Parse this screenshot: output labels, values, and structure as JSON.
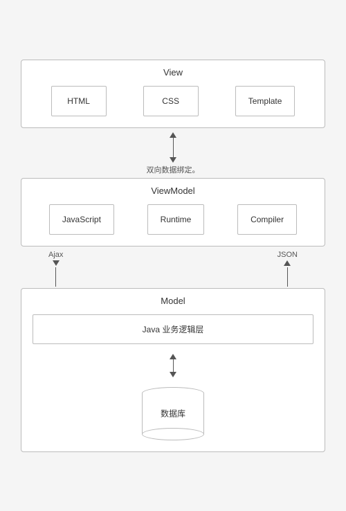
{
  "view": {
    "title": "View",
    "items": [
      "HTML",
      "CSS",
      "Template"
    ]
  },
  "arrow_view_vm": {
    "label": "双向数据绑定。"
  },
  "viewmodel": {
    "title": "ViewModel",
    "items": [
      "JavaScript",
      "Runtime",
      "Compiler"
    ]
  },
  "arrow_vm_model": {
    "left_label": "Ajax",
    "right_label": "JSON"
  },
  "model": {
    "title": "Model",
    "java_label": "Java 业务逻辑层",
    "db_label": "数据库"
  }
}
